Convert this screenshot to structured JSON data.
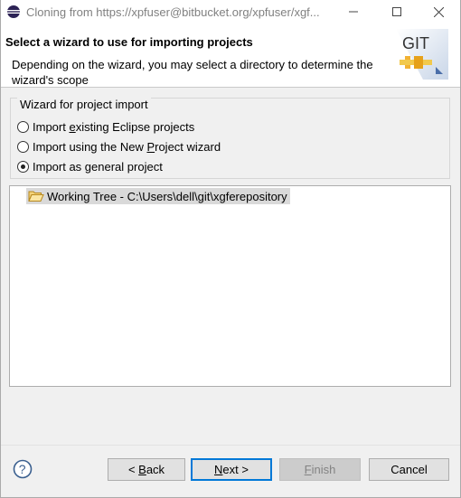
{
  "window": {
    "title": "Cloning from https://xpfuser@bitbucket.org/xpfuser/xgf..."
  },
  "header": {
    "title": "Select a wizard to use for importing projects",
    "description": "Depending on the wizard, you may select a directory to determine the wizard's scope",
    "logo_text": "GIT"
  },
  "wizard_group": {
    "title": "Wizard for project import",
    "options": [
      {
        "pre": "Import ",
        "mn": "e",
        "post": "xisting Eclipse projects",
        "selected": false
      },
      {
        "pre": "Import using the New ",
        "mn": "P",
        "post": "roject wizard",
        "selected": false
      },
      {
        "pre": "Import as ",
        "mn": "g",
        "post": "eneral project",
        "selected": true
      }
    ]
  },
  "tree": {
    "items": [
      {
        "label": "Working Tree - C:\\Users\\dell\\git\\xgferepository",
        "icon": "folder-open-icon"
      }
    ]
  },
  "buttons": {
    "back": {
      "pre": "< ",
      "mn": "B",
      "post": "ack"
    },
    "next": {
      "pre": "",
      "mn": "N",
      "post": "ext >"
    },
    "finish": {
      "pre": "",
      "mn": "F",
      "post": "inish"
    },
    "cancel": {
      "pre": "Cancel",
      "mn": "",
      "post": ""
    }
  },
  "colors": {
    "accent": "#0078d7",
    "tree_selection": "#d9d9d9"
  }
}
